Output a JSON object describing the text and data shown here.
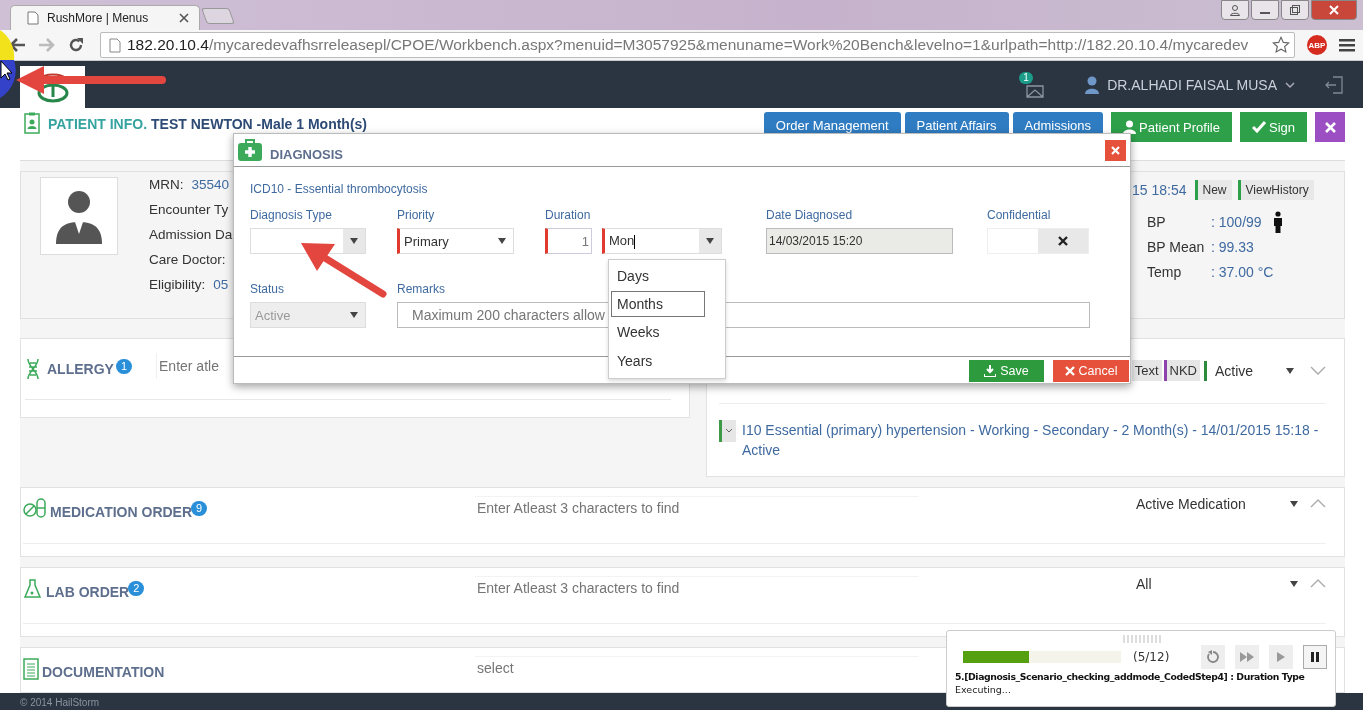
{
  "browser": {
    "tab_title": "RushMore | Menus",
    "url_host": "182.20.10.4",
    "url_path": "/mycaredevafhsrreleasepl/CPOE/Workbench.aspx?menuid=M3057925&menuname=Work%20Bench&levelno=1&urlpath=http://182.20.10.4/mycaredev",
    "extension": "ABP"
  },
  "header": {
    "notification_count": "1",
    "user_name": "DR.ALHADI FAISAL MUSA"
  },
  "patient": {
    "heading": "PATIENT INFO.",
    "name": "TEST NEWTON -Male 1 Month(s)",
    "details": [
      {
        "label": "MRN:",
        "value": "35540"
      },
      {
        "label": "Encounter Ty"
      },
      {
        "label": "Admission Da"
      },
      {
        "label": "Care Doctor:"
      },
      {
        "label": "Eligibility:",
        "value": "05"
      }
    ],
    "timestamp": "15 18:54",
    "actions": [
      "New",
      "ViewHistory"
    ],
    "vitals": [
      {
        "label": "BP",
        "value": ": 100/99",
        "figure": true
      },
      {
        "label": "BP Mean",
        "value": ": 99.33",
        "figure": false
      },
      {
        "label": "Temp",
        "value": ": 37.00 °C",
        "figure": false
      }
    ]
  },
  "nav_buttons": [
    {
      "kind": "tab",
      "label": "Order Management"
    },
    {
      "kind": "tab",
      "label": "Patient Affairs"
    },
    {
      "kind": "tab",
      "label": "Admissions"
    },
    {
      "kind": "profile",
      "label": "Patient Profile"
    },
    {
      "kind": "sign",
      "label": "Sign"
    },
    {
      "kind": "close"
    }
  ],
  "allergy": {
    "title": "ALLERGY",
    "count": "1",
    "placeholder": "Enter atle"
  },
  "diagnosis_panel": {
    "tags": [
      {
        "label": "Text"
      },
      {
        "label": "NKD",
        "color": "#8e44ad"
      }
    ],
    "status_filter": {
      "value": "Active",
      "color": "#2e8b3e"
    },
    "expanded": false,
    "entries": [
      {
        "text": "I10 Essential (primary) hypertension - Working - Secondary - 2 Month(s) - 14/01/2015 15:18 - Active",
        "color": "#3c9a46"
      }
    ]
  },
  "orders": [
    {
      "kind": "medication",
      "title": "MEDICATION ORDER",
      "count": "9",
      "placeholder": "Enter Atleast 3 characters to find",
      "filter": "Active Medication",
      "expanded": true
    },
    {
      "kind": "lab",
      "title": "LAB ORDER",
      "count": "2",
      "placeholder": "Enter Atleast 3 characters to find",
      "filter": "All",
      "expanded": true
    },
    {
      "kind": "documentation",
      "title": "DOCUMENTATION",
      "placeholder": "select"
    }
  ],
  "footer": "© 2014 HailStorm",
  "dialog": {
    "title": "DIAGNOSIS",
    "code": "ICD10 - Essential thrombocytosis",
    "diagnosis_type": {
      "label": "Diagnosis Type",
      "required": false
    },
    "priority": {
      "label": "Priority",
      "value": "Primary",
      "required": true
    },
    "duration": {
      "label": "Duration",
      "value": "1",
      "unit": "Mon",
      "required": true,
      "options": [
        {
          "label": "Days",
          "selected": false
        },
        {
          "label": "Months",
          "selected": true
        },
        {
          "label": "Weeks",
          "selected": false
        },
        {
          "label": "Years",
          "selected": false
        }
      ]
    },
    "date_diagnosed": {
      "label": "Date Diagnosed",
      "value": "14/03/2015 15:20"
    },
    "confidential": {
      "label": "Confidential",
      "checked": false
    },
    "status": {
      "label": "Status",
      "value": "Active",
      "disabled": true
    },
    "remarks": {
      "label": "Remarks",
      "placeholder": "Maximum 200 characters allow"
    },
    "buttons": [
      {
        "kind": "save",
        "label": "Save"
      },
      {
        "kind": "cancel",
        "label": "Cancel"
      }
    ]
  },
  "runner": {
    "level": 0.42,
    "counter": "(5/12)",
    "step": "5.[Diagnosis_Scenario_checking_addmode_CodedStep4] : Duration Type",
    "status": "Executing..."
  }
}
